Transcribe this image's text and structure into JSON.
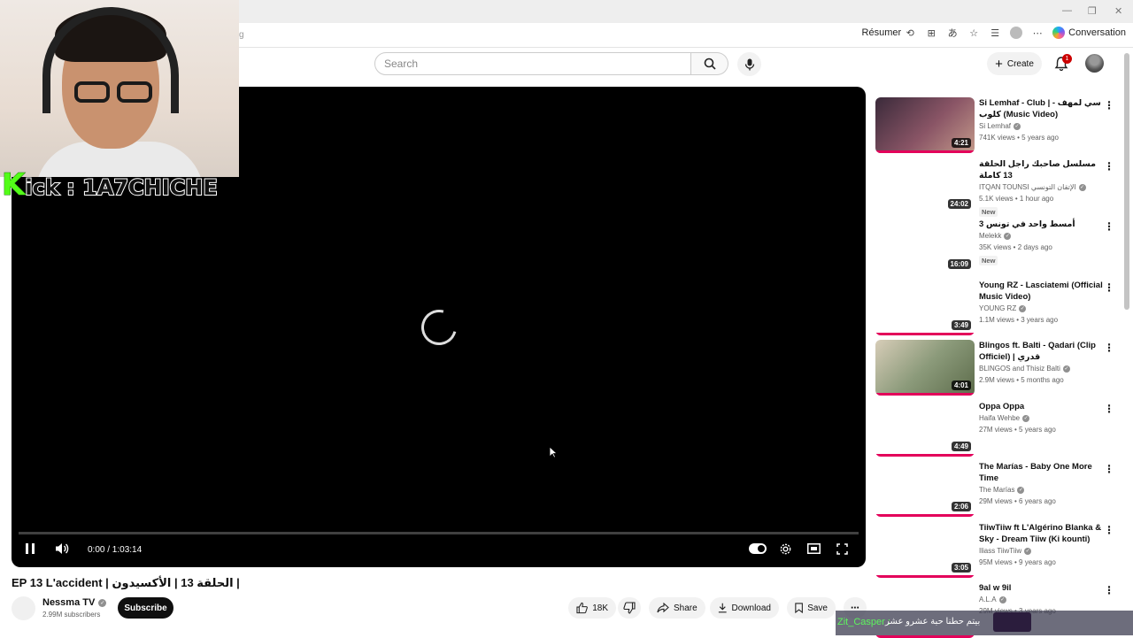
{
  "browser": {
    "address_fragment": "g",
    "resume_label": "Résumer",
    "conversation_label": "Conversation"
  },
  "header": {
    "search_placeholder": "Search",
    "create_label": "Create",
    "notification_count": "1"
  },
  "player": {
    "time": "0:00 / 1:03:14",
    "progress": 0
  },
  "stream_overlay": {
    "kick_text": "ick : 1A7CHICHE",
    "kick_k": "K",
    "chat_user": "Zit_Casper :",
    "chat_message": "بيتم حطنا حبة عشرو عشر"
  },
  "video": {
    "title": "EP 13 L'accident | الحلقة 13 | الأكسيدون |",
    "channel": "Nessma TV",
    "subscribers": "2.99M subscribers",
    "subscribe_label": "Subscribe",
    "likes": "18K",
    "share_label": "Share",
    "download_label": "Download",
    "save_label": "Save"
  },
  "recommendations": [
    {
      "title": "Si Lemhaf - Club | سي لمهف - كلوب (Music Video)",
      "channel": "Si Lemhaf",
      "meta": "741K views • 5 years ago",
      "duration": "4:21",
      "new": "",
      "thumb": "filled"
    },
    {
      "title": "مسلسل صاحبك راجل الحلقة 13 كاملة",
      "channel": "ITQAN TOUNSI الإتقان التونسي",
      "meta": "5.1K views • 1 hour ago",
      "duration": "24:02",
      "new": "New",
      "thumb": "blank"
    },
    {
      "title": "3 أمسط واحد في تونس",
      "channel": "Melekk",
      "meta": "35K views • 2 days ago",
      "duration": "16:09",
      "new": "New",
      "thumb": "blank"
    },
    {
      "title": "Young RZ - Lasciatemi (Official Music Video)",
      "channel": "YOUNG RZ",
      "meta": "1.1M views • 3 years ago",
      "duration": "3:49",
      "new": "",
      "thumb": "blank"
    },
    {
      "title": "Blingos ft. Balti - Qadari (Clip Officiel) | قدري",
      "channel": "BLINGOS and Thisiz Balti",
      "meta": "2.9M views • 5 months ago",
      "duration": "4:01",
      "new": "",
      "thumb": "filled2"
    },
    {
      "title": "Oppa Oppa",
      "channel": "Haifa Wehbe",
      "meta": "27M views • 5 years ago",
      "duration": "4:49",
      "new": "",
      "thumb": "blank"
    },
    {
      "title": "The Marías - Baby One More Time",
      "channel": "The Marías",
      "meta": "29M views • 6 years ago",
      "duration": "2:06",
      "new": "",
      "thumb": "blank"
    },
    {
      "title": "TiiwTiiw ft L'Algérino Blanka & Sky - Dream Tiiw (Ki kounti)",
      "channel": "Iliass TiiwTiiw",
      "meta": "95M views • 9 years ago",
      "duration": "3:05",
      "new": "",
      "thumb": "blank"
    },
    {
      "title": "9al w 9il",
      "channel": "A.L.A",
      "meta": "29M views • 3 years ago",
      "duration": "",
      "new": "",
      "thumb": "blank"
    }
  ]
}
